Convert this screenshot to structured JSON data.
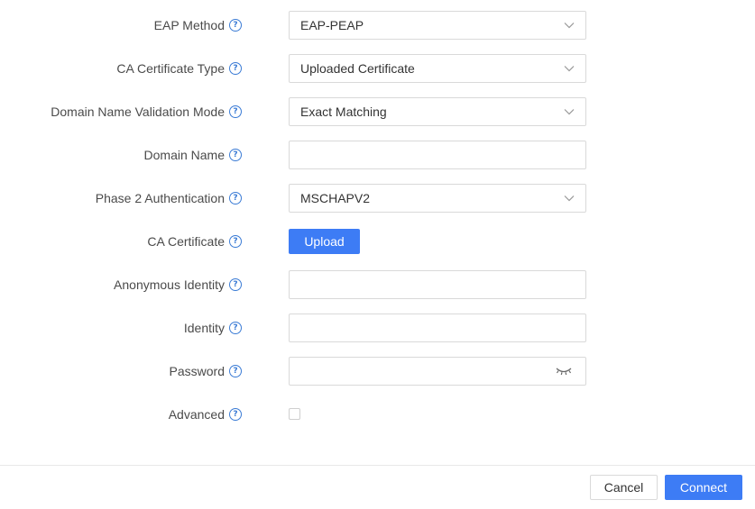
{
  "form": {
    "eap_method": {
      "label": "EAP Method",
      "value": "EAP-PEAP"
    },
    "ca_cert_type": {
      "label": "CA Certificate Type",
      "value": "Uploaded Certificate"
    },
    "domain_validation": {
      "label": "Domain Name Validation Mode",
      "value": "Exact Matching"
    },
    "domain_name": {
      "label": "Domain Name",
      "value": "",
      "placeholder": ""
    },
    "phase2_auth": {
      "label": "Phase 2 Authentication",
      "value": "MSCHAPV2"
    },
    "ca_cert": {
      "label": "CA Certificate",
      "button": "Upload"
    },
    "anonymous_identity": {
      "label": "Anonymous Identity",
      "value": "",
      "placeholder": ""
    },
    "identity": {
      "label": "Identity",
      "value": "",
      "placeholder": ""
    },
    "password": {
      "label": "Password",
      "value": "",
      "placeholder": ""
    },
    "advanced": {
      "label": "Advanced",
      "checked": false
    }
  },
  "footer": {
    "cancel": "Cancel",
    "connect": "Connect"
  },
  "colors": {
    "primary": "#3d7cf5",
    "help_icon": "#3a7bd5",
    "border": "#d9d9d9"
  },
  "icons": {
    "help": "question-circle-icon",
    "chevron": "chevron-down-icon",
    "eye": "eye-closed-icon"
  }
}
